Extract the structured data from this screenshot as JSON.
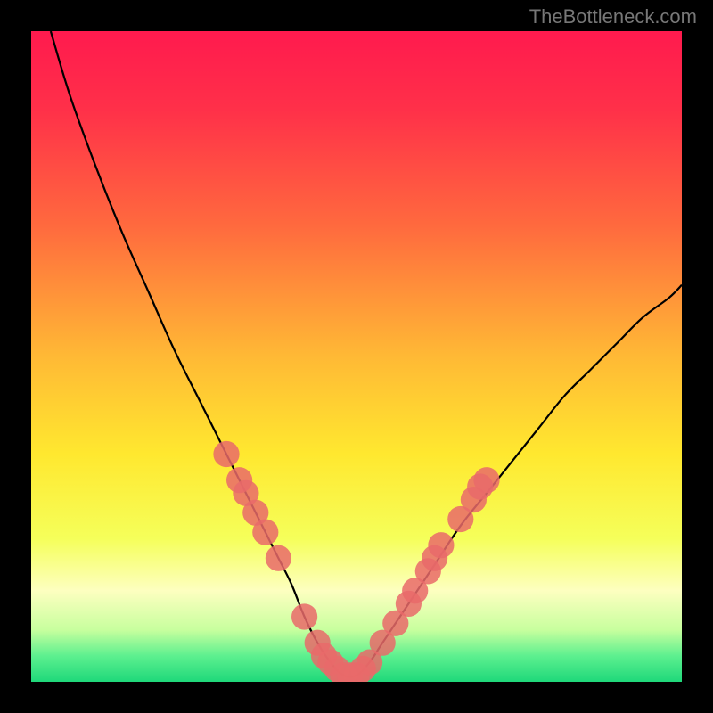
{
  "watermark": "TheBottleneck.com",
  "chart_data": {
    "type": "line",
    "title": "",
    "xlabel": "",
    "ylabel": "",
    "xlim": [
      0,
      100
    ],
    "ylim": [
      0,
      100
    ],
    "background": {
      "type": "vertical-gradient",
      "stops": [
        {
          "offset": 0.0,
          "color": "#ff1a4e"
        },
        {
          "offset": 0.12,
          "color": "#ff3049"
        },
        {
          "offset": 0.3,
          "color": "#ff6a3e"
        },
        {
          "offset": 0.5,
          "color": "#ffb935"
        },
        {
          "offset": 0.65,
          "color": "#ffe82f"
        },
        {
          "offset": 0.78,
          "color": "#f5ff5a"
        },
        {
          "offset": 0.86,
          "color": "#fdffc0"
        },
        {
          "offset": 0.92,
          "color": "#c8ff9e"
        },
        {
          "offset": 0.96,
          "color": "#5df08f"
        },
        {
          "offset": 1.0,
          "color": "#1fd87a"
        }
      ]
    },
    "series": [
      {
        "name": "curve",
        "color": "#000000",
        "x": [
          3,
          6,
          10,
          14,
          18,
          22,
          26,
          30,
          34,
          36,
          38,
          40,
          42,
          44,
          46,
          48,
          50,
          52,
          54,
          58,
          62,
          66,
          70,
          74,
          78,
          82,
          86,
          90,
          94,
          98,
          100
        ],
        "y": [
          100,
          90,
          79,
          69,
          60,
          51,
          43,
          35,
          27,
          23,
          19,
          15,
          10,
          6,
          3,
          1,
          1,
          3,
          6,
          12,
          18,
          24,
          29,
          34,
          39,
          44,
          48,
          52,
          56,
          59,
          61
        ]
      }
    ],
    "markers": {
      "name": "highlighted-points",
      "color": "#e96a6a",
      "radius": 2.0,
      "points": [
        {
          "x": 30,
          "y": 35
        },
        {
          "x": 32,
          "y": 31
        },
        {
          "x": 33,
          "y": 29
        },
        {
          "x": 34.5,
          "y": 26
        },
        {
          "x": 36,
          "y": 23
        },
        {
          "x": 38,
          "y": 19
        },
        {
          "x": 42,
          "y": 10
        },
        {
          "x": 44,
          "y": 6
        },
        {
          "x": 45,
          "y": 4
        },
        {
          "x": 46,
          "y": 3
        },
        {
          "x": 47,
          "y": 2
        },
        {
          "x": 48,
          "y": 1
        },
        {
          "x": 49,
          "y": 1
        },
        {
          "x": 50,
          "y": 1
        },
        {
          "x": 51,
          "y": 2
        },
        {
          "x": 52,
          "y": 3
        },
        {
          "x": 54,
          "y": 6
        },
        {
          "x": 56,
          "y": 9
        },
        {
          "x": 58,
          "y": 12
        },
        {
          "x": 59,
          "y": 14
        },
        {
          "x": 61,
          "y": 17
        },
        {
          "x": 62,
          "y": 19
        },
        {
          "x": 63,
          "y": 21
        },
        {
          "x": 66,
          "y": 25
        },
        {
          "x": 68,
          "y": 28
        },
        {
          "x": 69,
          "y": 30
        },
        {
          "x": 70,
          "y": 31
        }
      ]
    }
  }
}
